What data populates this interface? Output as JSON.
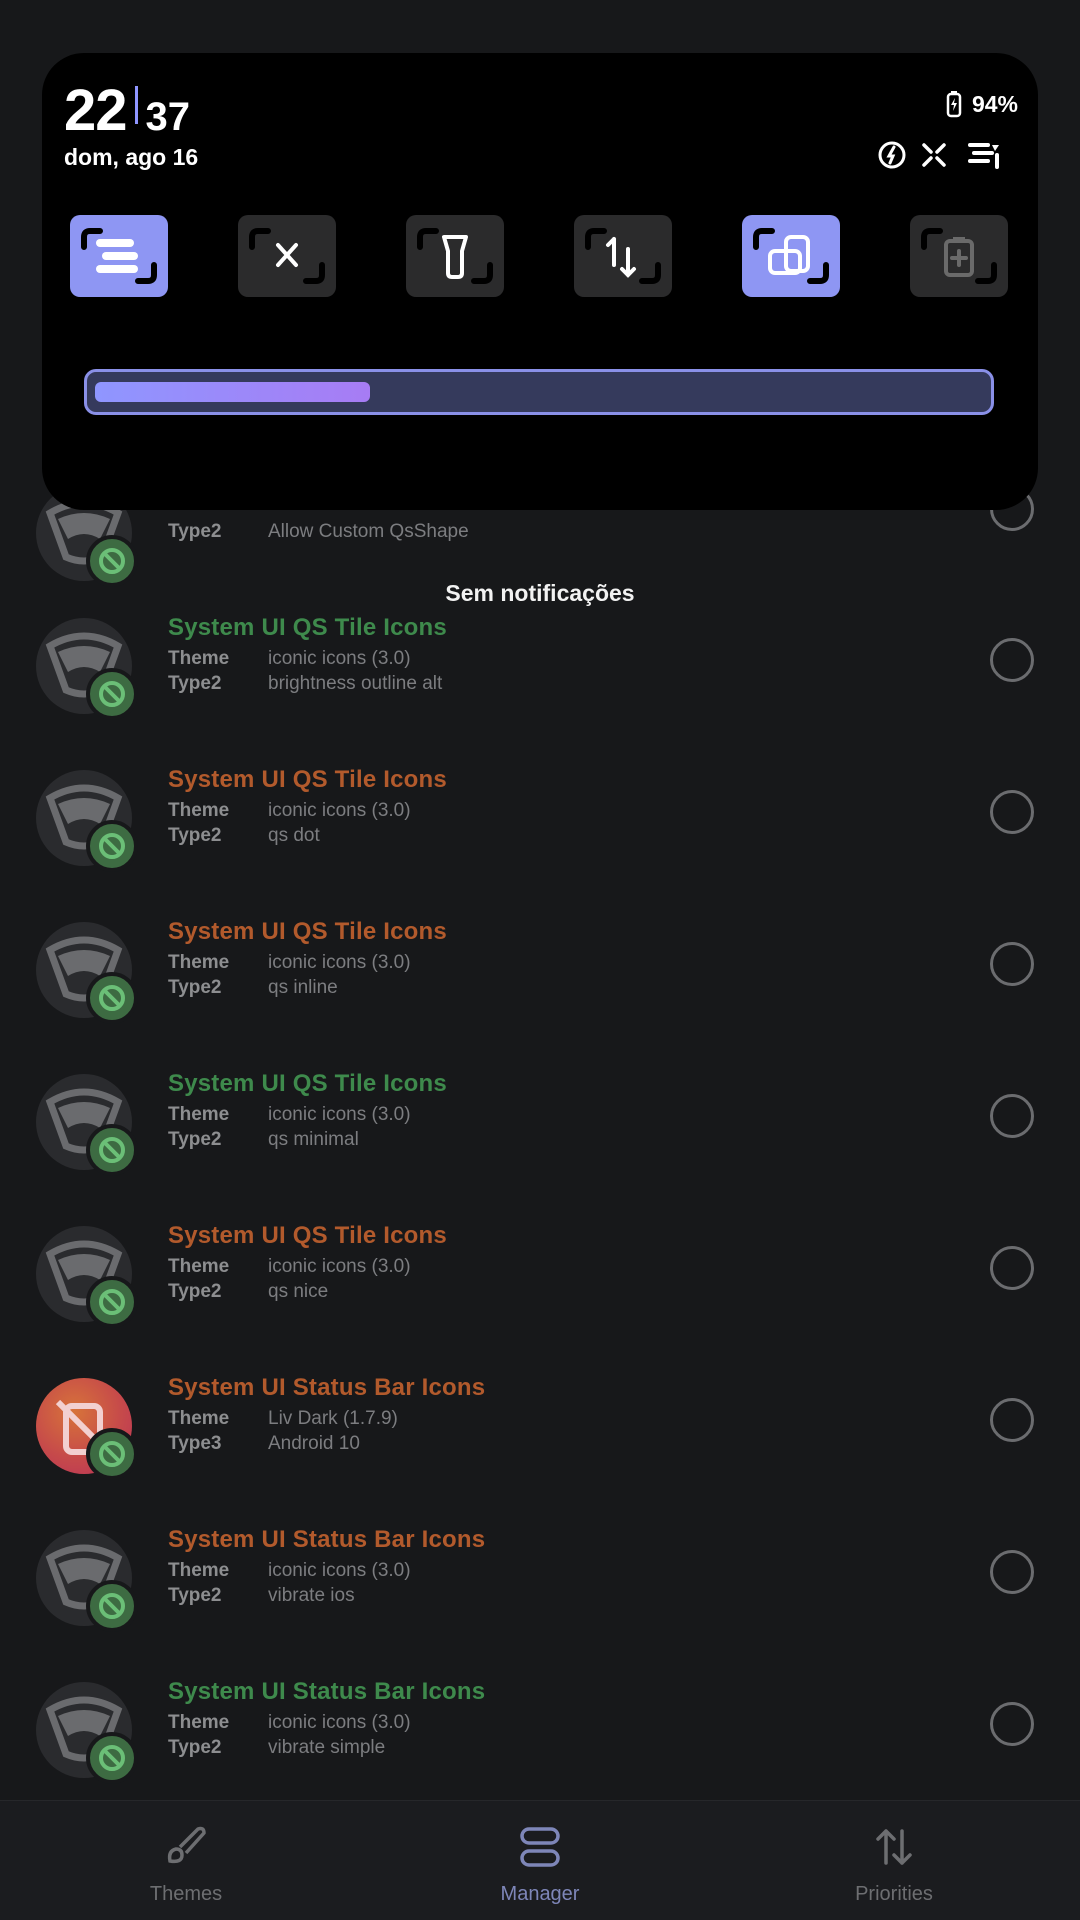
{
  "shade": {
    "clock_hours": "22",
    "clock_minutes": "37",
    "date": "dom, ago 16",
    "battery_percent": "94%",
    "status_icons": [
      "data-saver-icon",
      "sync-off-icon",
      "signal-bars-icon"
    ],
    "tiles": [
      {
        "name": "tile-interruptions",
        "icon": "lines-icon",
        "active": true
      },
      {
        "name": "tile-bluetooth",
        "icon": "bluetooth-icon",
        "active": false
      },
      {
        "name": "tile-flashlight",
        "icon": "flashlight-icon",
        "active": false
      },
      {
        "name": "tile-mobile-data",
        "icon": "data-arrows-icon",
        "active": false
      },
      {
        "name": "tile-auto-rotate",
        "icon": "rotate-icon",
        "active": true
      },
      {
        "name": "tile-battery-saver",
        "icon": "battery-plus-icon",
        "active": false
      }
    ],
    "brightness_level": 0.31
  },
  "no_notifications": "Sem notificações",
  "list": {
    "label_theme": "Theme",
    "items": [
      {
        "title": "System UI QS Tile Icons",
        "title_color": "green",
        "type_label": "Type2",
        "theme": "iconic icons (3.0)",
        "type": "brightness outline alt",
        "avatar": "plain"
      },
      {
        "title": "System UI QS Tile Icons",
        "title_color": "orange",
        "type_label": "Type2",
        "theme": "iconic icons (3.0)",
        "type": "qs dot",
        "avatar": "plain"
      },
      {
        "title": "System UI QS Tile Icons",
        "title_color": "orange",
        "type_label": "Type2",
        "theme": "iconic icons (3.0)",
        "type": "qs inline",
        "avatar": "plain"
      },
      {
        "title": "System UI QS Tile Icons",
        "title_color": "green",
        "type_label": "Type2",
        "theme": "iconic icons (3.0)",
        "type": "qs minimal",
        "avatar": "plain"
      },
      {
        "title": "System UI QS Tile Icons",
        "title_color": "orange",
        "type_label": "Type2",
        "theme": "iconic icons (3.0)",
        "type": "qs nice",
        "avatar": "plain"
      },
      {
        "title": "System UI Status Bar Icons",
        "title_color": "orange",
        "type_label": "Type3",
        "theme": "Liv Dark (1.7.9)",
        "type": "Android 10",
        "avatar": "colored"
      },
      {
        "title": "System UI Status Bar Icons",
        "title_color": "orange",
        "type_label": "Type2",
        "theme": "iconic icons (3.0)",
        "type": "vibrate ios",
        "avatar": "plain"
      },
      {
        "title": "System UI Status Bar Icons",
        "title_color": "green",
        "type_label": "Type2",
        "theme": "iconic icons (3.0)",
        "type": "vibrate simple",
        "avatar": "plain"
      }
    ],
    "partial_item": {
      "type_label": "Type2",
      "type": "Allow Custom QsShape"
    }
  },
  "nav": {
    "themes": "Themes",
    "manager": "Manager",
    "priorities": "Priorities"
  }
}
